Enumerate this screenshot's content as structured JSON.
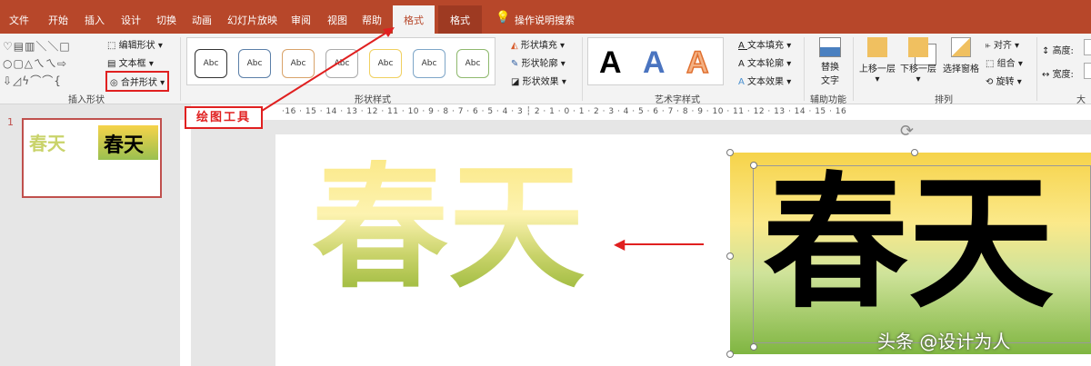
{
  "tabs": [
    "文件",
    "开始",
    "插入",
    "设计",
    "切换",
    "动画",
    "幻灯片放映",
    "审阅",
    "视图",
    "帮助"
  ],
  "active_tab": "格式",
  "second_tab": "格式",
  "search": "操作说明搜索",
  "insert_shapes": {
    "edit_shape": "编辑形状",
    "textbox": "文本框",
    "merge_shapes": "合并形状",
    "label": "插入形状"
  },
  "shape_styles": {
    "sample": "Abc",
    "fill": "形状填充",
    "outline": "形状轮廓",
    "effects": "形状效果",
    "label": "形状样式"
  },
  "wordart": {
    "letter": "A",
    "fill": "文本填充",
    "outline": "文本轮廓",
    "effects": "文本效果",
    "label": "艺术字样式"
  },
  "accessibility": {
    "alt_text_1": "替换",
    "alt_text_2": "文字",
    "label": "辅助功能"
  },
  "arrange": {
    "bring_forward": "上移一层",
    "send_backward": "下移一层",
    "selection_pane": "选择窗格",
    "align": "对齐",
    "group": "组合",
    "rotate": "旋转",
    "label": "排列"
  },
  "size": {
    "height": "高度:",
    "width": "宽度:",
    "label": "大小"
  },
  "ruler": "·16 · 15 · 14 · 13 · 12 · 11 · 10 · 9 · 8 · 7 · 6 · 5 · 4 · 3 ┆ 2 · 1 · 0 · 1 · 2 · 3 · 4 · 5 · 6 · 7 · 8 · 9 · 10 · 11 · 12 · 13 · 14 · 15 · 16",
  "slide_number": "1",
  "slide_text": "春天",
  "annotation": "绘图工具",
  "watermark": "头条 @设计为人",
  "colors": {
    "accent": "#b7472a",
    "annotation": "#e02020"
  }
}
